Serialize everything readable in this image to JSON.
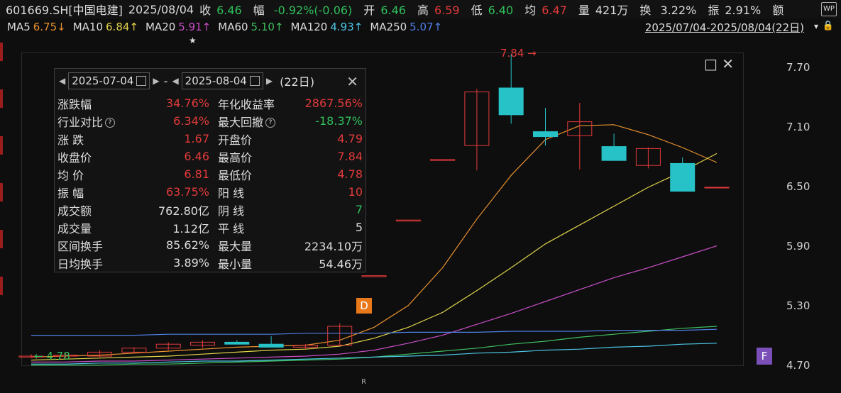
{
  "header": {
    "stock": "601669.SH[中国电建]",
    "date": "2025/08/04",
    "close_label": "收",
    "close_value": "6.46",
    "change_label": "幅",
    "change_value": "-0.92%(-0.06)",
    "open_label": "开",
    "open_value": "6.46",
    "high_label": "高",
    "high_value": "6.59",
    "low_label": "低",
    "low_value": "6.40",
    "avg_label": "均",
    "avg_value": "6.47",
    "volume_label": "量",
    "volume_value": "421万",
    "turnover_label": "换",
    "turnover_value": "3.22%",
    "amplitude_label": "振",
    "amplitude_value": "2.91%",
    "amount_label": "额",
    "wp_icon": "WP"
  },
  "ma_bar": {
    "items": [
      {
        "label": "MA5",
        "value": "6.75↓",
        "color": "#e8912e"
      },
      {
        "label": "MA10",
        "value": "6.84↑",
        "color": "#e0d24a"
      },
      {
        "label": "MA20",
        "value": "5.91↑",
        "color": "#c94fc9"
      },
      {
        "label": "MA60",
        "value": "5.10↑",
        "color": "#3fbf5f"
      },
      {
        "label": "MA120",
        "value": "4.93↑",
        "color": "#4cc7e6"
      },
      {
        "label": "MA250",
        "value": "5.07↑",
        "color": "#4f7fe6"
      }
    ],
    "range": "2025/07/04-2025/08/04(22日)",
    "dropdown_icon": "▾",
    "lock_icon": "🔒"
  },
  "panel": {
    "start_date": "2025-07-04",
    "end_date": "2025-08-04",
    "sep": "-",
    "days": "(22日)",
    "close_icon": "✕",
    "rows": [
      {
        "l1": "涨跌幅",
        "v1": "34.76%",
        "c1": "up",
        "l2": "年化收益率",
        "v2": "2867.56%",
        "c2": "up"
      },
      {
        "l1": "行业对比",
        "v1": "6.34%",
        "c1": "up",
        "l2": "最大回撤",
        "v2": "-18.37%",
        "c2": "down"
      },
      {
        "l1": "涨 跌",
        "v1": "1.67",
        "c1": "up",
        "l2": "开盘价",
        "v2": "4.79",
        "c2": "up"
      },
      {
        "l1": "收盘价",
        "v1": "6.46",
        "c1": "up",
        "l2": "最高价",
        "v2": "7.84",
        "c2": "up"
      },
      {
        "l1": "均 价",
        "v1": "6.81",
        "c1": "up",
        "l2": "最低价",
        "v2": "4.78",
        "c2": "up"
      },
      {
        "l1": "振 幅",
        "v1": "63.75%",
        "c1": "up",
        "l2": "阳 线",
        "v2": "10",
        "c2": "up"
      },
      {
        "l1": "成交额",
        "v1": "762.80亿",
        "c1": "white",
        "l2": "阴 线",
        "v2": "7",
        "c2": "down"
      },
      {
        "l1": "成交量",
        "v1": "1.12亿",
        "c1": "white",
        "l2": "平 线",
        "v2": "5",
        "c2": "white"
      },
      {
        "l1": "区间换手",
        "v1": "85.62%",
        "c1": "white",
        "l2": "最大量",
        "v2": "2234.10万",
        "c2": "white"
      },
      {
        "l1": "日均换手",
        "v1": "3.89%",
        "c1": "white",
        "l2": "最小量",
        "v2": "54.46万",
        "c2": "white"
      }
    ]
  },
  "chart_data": {
    "type": "candlestick",
    "y_ticks": [
      "7.70",
      "7.10",
      "6.50",
      "5.90",
      "5.30",
      "4.70"
    ],
    "ylim": [
      4.7,
      7.7
    ],
    "high_marker": "7.84",
    "low_marker": "4.78",
    "badge_d": "D",
    "badge_f": "F",
    "star": "★",
    "r_label": "R",
    "candles": [
      {
        "o": 4.79,
        "h": 4.82,
        "l": 4.78,
        "c": 4.8
      },
      {
        "o": 4.8,
        "h": 4.83,
        "l": 4.78,
        "c": 4.81
      },
      {
        "o": 4.8,
        "h": 4.86,
        "l": 4.79,
        "c": 4.84
      },
      {
        "o": 4.84,
        "h": 4.89,
        "l": 4.83,
        "c": 4.88
      },
      {
        "o": 4.88,
        "h": 4.94,
        "l": 4.86,
        "c": 4.92
      },
      {
        "o": 4.91,
        "h": 4.96,
        "l": 4.88,
        "c": 4.94
      },
      {
        "o": 4.94,
        "h": 4.96,
        "l": 4.92,
        "c": 4.92
      },
      {
        "o": 4.92,
        "h": 5.0,
        "l": 4.89,
        "c": 4.89
      },
      {
        "o": 4.89,
        "h": 4.92,
        "l": 4.87,
        "c": 4.91
      },
      {
        "o": 4.91,
        "h": 5.13,
        "l": 4.9,
        "c": 5.1
      },
      {
        "o": 5.6,
        "h": 5.6,
        "l": 5.6,
        "c": 5.61
      },
      {
        "o": 6.16,
        "h": 6.16,
        "l": 6.16,
        "c": 6.17
      },
      {
        "o": 6.77,
        "h": 6.77,
        "l": 6.77,
        "c": 6.78
      },
      {
        "o": 6.92,
        "h": 7.49,
        "l": 6.67,
        "c": 7.46
      },
      {
        "o": 7.5,
        "h": 7.84,
        "l": 7.14,
        "c": 7.23
      },
      {
        "o": 7.06,
        "h": 7.3,
        "l": 6.92,
        "c": 7.01
      },
      {
        "o": 7.02,
        "h": 7.35,
        "l": 6.68,
        "c": 7.16
      },
      {
        "o": 6.91,
        "h": 7.04,
        "l": 6.77,
        "c": 6.77
      },
      {
        "o": 6.72,
        "h": 6.9,
        "l": 6.69,
        "c": 6.89
      },
      {
        "o": 6.74,
        "h": 6.8,
        "l": 6.51,
        "c": 6.46
      },
      {
        "o": 6.5,
        "h": 6.5,
        "l": 6.5,
        "c": 6.5
      }
    ],
    "series": [
      {
        "name": "MA5",
        "color": "#e8912e",
        "values": [
          4.79,
          4.8,
          4.81,
          4.83,
          4.85,
          4.87,
          4.89,
          4.9,
          4.91,
          4.96,
          5.09,
          5.31,
          5.69,
          6.18,
          6.62,
          6.98,
          7.12,
          7.13,
          7.03,
          6.9,
          6.75
        ]
      },
      {
        "name": "MA10",
        "color": "#e0d24a",
        "values": [
          4.76,
          4.77,
          4.78,
          4.79,
          4.8,
          4.82,
          4.84,
          4.86,
          4.87,
          4.9,
          4.98,
          5.09,
          5.24,
          5.46,
          5.69,
          5.93,
          6.12,
          6.31,
          6.5,
          6.66,
          6.84
        ]
      },
      {
        "name": "MA20",
        "color": "#c94fc9",
        "values": [
          4.74,
          4.74,
          4.75,
          4.75,
          4.76,
          4.77,
          4.78,
          4.79,
          4.8,
          4.82,
          4.86,
          4.93,
          5.01,
          5.12,
          5.23,
          5.35,
          5.47,
          5.59,
          5.69,
          5.8,
          5.91
        ]
      },
      {
        "name": "MA60",
        "color": "#3fbf5f",
        "values": [
          4.71,
          4.71,
          4.71,
          4.72,
          4.72,
          4.73,
          4.74,
          4.75,
          4.76,
          4.77,
          4.79,
          4.82,
          4.85,
          4.88,
          4.92,
          4.95,
          4.99,
          5.02,
          5.05,
          5.08,
          5.1
        ]
      },
      {
        "name": "MA120",
        "color": "#4cc7e6",
        "values": [
          4.72,
          4.72,
          4.73,
          4.73,
          4.74,
          4.75,
          4.75,
          4.76,
          4.77,
          4.78,
          4.79,
          4.8,
          4.81,
          4.83,
          4.84,
          4.86,
          4.87,
          4.89,
          4.9,
          4.92,
          4.93
        ]
      },
      {
        "name": "MA250",
        "color": "#4f7fe6",
        "values": [
          5.01,
          5.01,
          5.01,
          5.01,
          5.02,
          5.02,
          5.02,
          5.02,
          5.03,
          5.03,
          5.03,
          5.04,
          5.04,
          5.04,
          5.05,
          5.05,
          5.05,
          5.06,
          5.06,
          5.06,
          5.07
        ]
      }
    ]
  }
}
